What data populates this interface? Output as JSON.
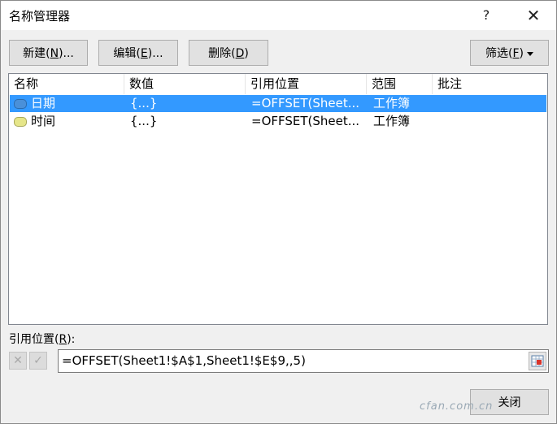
{
  "window": {
    "title": "名称管理器",
    "help_glyph": "?",
    "close_glyph": "✕"
  },
  "toolbar": {
    "new_label": "新建",
    "new_key": "N",
    "edit_label": "编辑",
    "edit_key": "E",
    "delete_label": "删除",
    "delete_key": "D",
    "filter_label": "筛选",
    "filter_key": "F"
  },
  "list": {
    "columns": [
      "名称",
      "数值",
      "引用位置",
      "范围",
      "批注"
    ],
    "rows": [
      {
        "name": "日期",
        "value": "{...}",
        "ref": "=OFFSET(Sheet...",
        "scope": "工作簿",
        "comment": "",
        "selected": true,
        "icon_color": "#4a90d9"
      },
      {
        "name": "时间",
        "value": "{...}",
        "ref": "=OFFSET(Sheet...",
        "scope": "工作簿",
        "comment": "",
        "selected": false,
        "icon_color": "#e6e68a"
      }
    ]
  },
  "reference": {
    "label": "引用位置",
    "key": "R",
    "cancel_glyph": "✕",
    "ok_glyph": "✓",
    "value": "=OFFSET(Sheet1!$A$1,Sheet1!$E$9,,5)"
  },
  "footer": {
    "close_label": "关闭"
  },
  "watermark": "cfan.com.cn"
}
